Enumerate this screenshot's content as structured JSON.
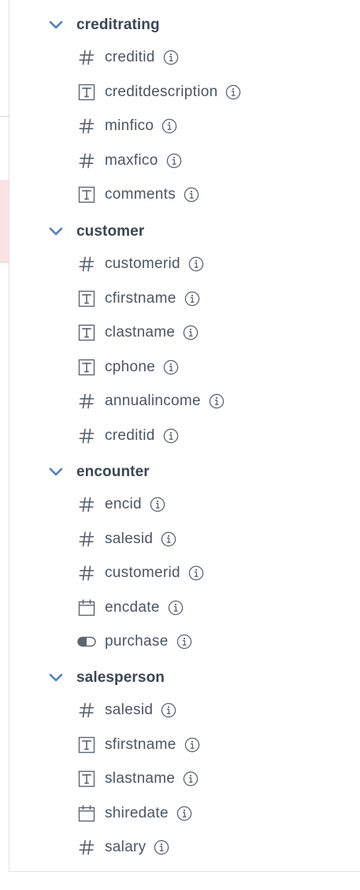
{
  "schema": {
    "tables": [
      {
        "name": "creditrating",
        "columns": [
          {
            "name": "creditid",
            "type": "number"
          },
          {
            "name": "creditdescription",
            "type": "text"
          },
          {
            "name": "minfico",
            "type": "number"
          },
          {
            "name": "maxfico",
            "type": "number"
          },
          {
            "name": "comments",
            "type": "text"
          }
        ]
      },
      {
        "name": "customer",
        "columns": [
          {
            "name": "customerid",
            "type": "number"
          },
          {
            "name": "cfirstname",
            "type": "text"
          },
          {
            "name": "clastname",
            "type": "text"
          },
          {
            "name": "cphone",
            "type": "text"
          },
          {
            "name": "annualincome",
            "type": "number"
          },
          {
            "name": "creditid",
            "type": "number"
          }
        ]
      },
      {
        "name": "encounter",
        "columns": [
          {
            "name": "encid",
            "type": "number"
          },
          {
            "name": "salesid",
            "type": "number"
          },
          {
            "name": "customerid",
            "type": "number"
          },
          {
            "name": "encdate",
            "type": "date"
          },
          {
            "name": "purchase",
            "type": "boolean"
          }
        ]
      },
      {
        "name": "salesperson",
        "columns": [
          {
            "name": "salesid",
            "type": "number"
          },
          {
            "name": "sfirstname",
            "type": "text"
          },
          {
            "name": "slastname",
            "type": "text"
          },
          {
            "name": "shiredate",
            "type": "date"
          },
          {
            "name": "salary",
            "type": "number"
          }
        ]
      }
    ]
  },
  "icons": {
    "expand": "chevron-down-icon",
    "info": "info-icon",
    "number": "hash-icon",
    "text": "text-type-icon",
    "date": "calendar-icon",
    "boolean": "toggle-icon"
  },
  "colors": {
    "chevron": "#4a80c8",
    "table_name": "#3a4654",
    "column_name": "#4b5563",
    "icon": "#5c6670",
    "left_highlight": "#fbe3e4"
  }
}
